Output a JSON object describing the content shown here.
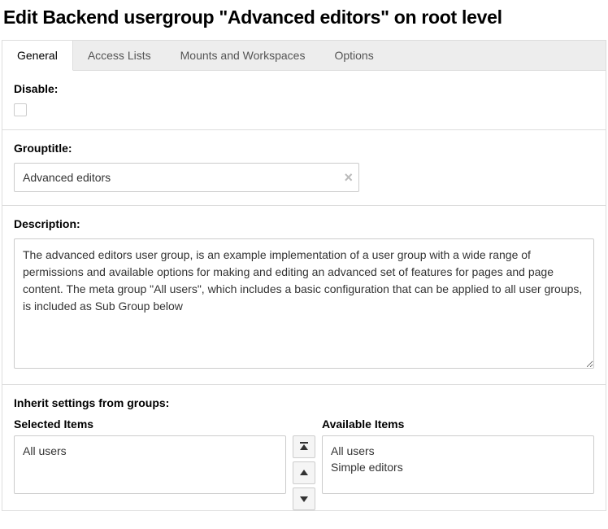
{
  "title": "Edit Backend usergroup \"Advanced editors\" on root level",
  "tabs": [
    {
      "label": "General",
      "active": true
    },
    {
      "label": "Access Lists",
      "active": false
    },
    {
      "label": "Mounts and Workspaces",
      "active": false
    },
    {
      "label": "Options",
      "active": false
    }
  ],
  "form": {
    "disable": {
      "label": "Disable:",
      "checked": false
    },
    "grouptitle": {
      "label": "Grouptitle:",
      "value": "Advanced editors"
    },
    "description": {
      "label": "Description:",
      "value": "The advanced editors user group, is an example implementation of a user group with a wide range of permissions and available options for making and editing an advanced set of features for pages and page content. The meta group \"All users\", which includes a basic configuration that can be applied to all user groups, is included as Sub Group below"
    },
    "inherit": {
      "label": "Inherit settings from groups:",
      "selected_label": "Selected Items",
      "available_label": "Available Items",
      "selected": [
        "All users"
      ],
      "available": [
        "All users",
        "Simple editors"
      ]
    }
  }
}
